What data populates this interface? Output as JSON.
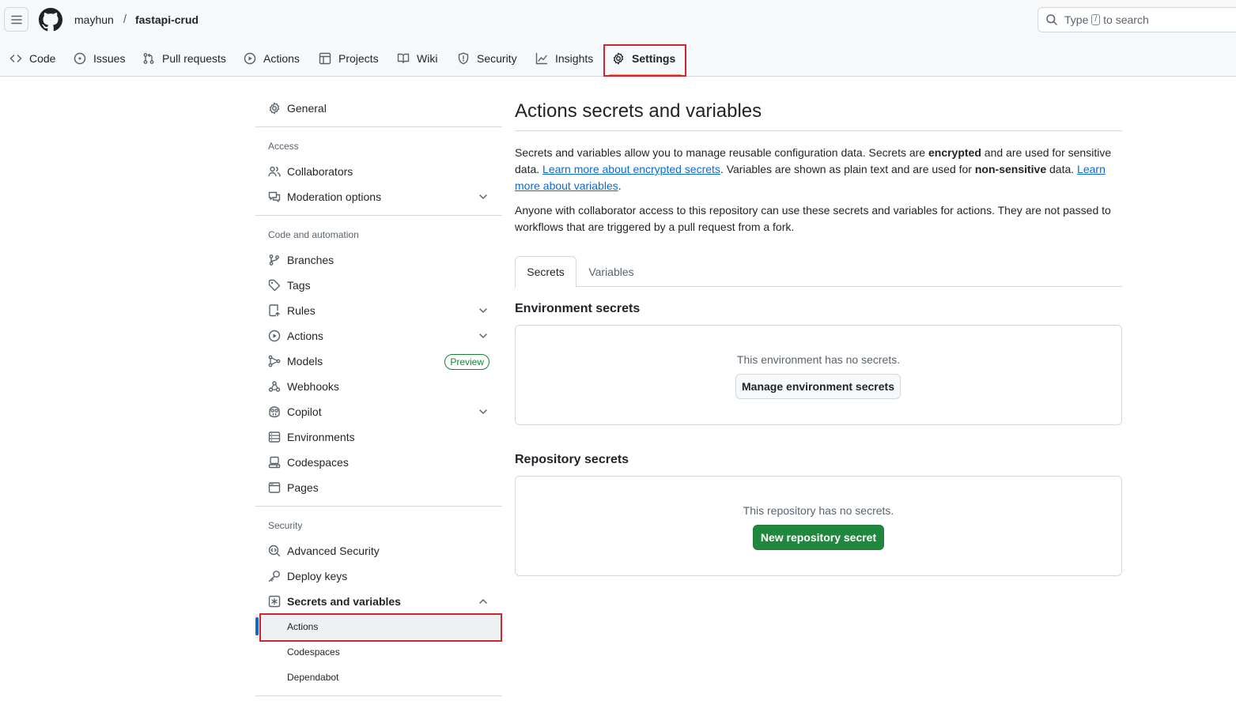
{
  "header": {
    "owner": "mayhun",
    "separator": "/",
    "repo": "fastapi-crud",
    "search": {
      "prefix": "Type",
      "key": "/",
      "suffix": "to search"
    }
  },
  "repo_nav": {
    "items": [
      {
        "label": "Code",
        "icon": "code-icon"
      },
      {
        "label": "Issues",
        "icon": "issue-opened-icon"
      },
      {
        "label": "Pull requests",
        "icon": "git-pull-request-icon"
      },
      {
        "label": "Actions",
        "icon": "play-icon"
      },
      {
        "label": "Projects",
        "icon": "table-icon"
      },
      {
        "label": "Wiki",
        "icon": "book-icon"
      },
      {
        "label": "Security",
        "icon": "shield-icon"
      },
      {
        "label": "Insights",
        "icon": "graph-icon"
      },
      {
        "label": "Settings",
        "icon": "gear-icon",
        "selected": true
      }
    ]
  },
  "sidebar": {
    "general": "General",
    "access_heading": "Access",
    "access": [
      "Collaborators",
      "Moderation options"
    ],
    "code_heading": "Code and automation",
    "code": [
      "Branches",
      "Tags",
      "Rules",
      "Actions",
      "Models",
      "Webhooks",
      "Copilot",
      "Environments",
      "Codespaces",
      "Pages"
    ],
    "models_badge": "Preview",
    "security_heading": "Security",
    "security": [
      "Advanced Security",
      "Deploy keys",
      "Secrets and variables"
    ],
    "secrets_sub": [
      "Actions",
      "Codespaces",
      "Dependabot"
    ]
  },
  "main": {
    "title": "Actions secrets and variables",
    "intro": {
      "p1_a": "Secrets and variables allow you to manage reusable configuration data. Secrets are ",
      "p1_b": "encrypted",
      "p1_c": " and are used for sensitive data. ",
      "link1": "Learn more about encrypted secrets",
      "p1_d": ". Variables are shown as plain text and are used for ",
      "p1_e": "non-sensitive",
      "p1_f": " data. ",
      "link2": "Learn more about variables",
      "p1_g": "."
    },
    "p2": "Anyone with collaborator access to this repository can use these secrets and variables for actions. They are not passed to workflows that are triggered by a pull request from a fork.",
    "tabs": [
      "Secrets",
      "Variables"
    ],
    "env_heading": "Environment secrets",
    "env_empty": "This environment has no secrets.",
    "env_button": "Manage environment secrets",
    "repo_heading": "Repository secrets",
    "repo_empty": "This repository has no secrets.",
    "repo_button": "New repository secret"
  },
  "colors": {
    "accent_blue": "#0969da",
    "primary_green": "#1f883d",
    "highlight_red": "#d1242f"
  }
}
